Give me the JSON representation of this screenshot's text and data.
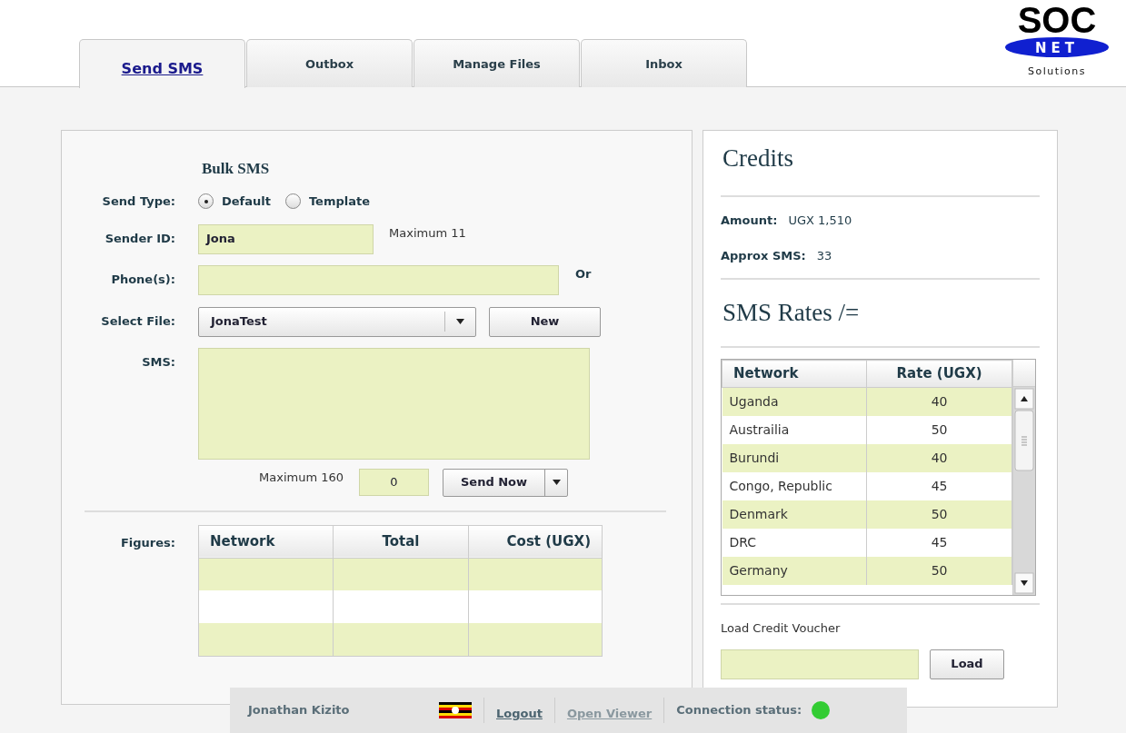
{
  "logo": {
    "top": "SOC",
    "band": "NET",
    "bottom": "Solutions"
  },
  "tabs": [
    {
      "label": "Send SMS",
      "selected": true
    },
    {
      "label": "Outbox",
      "selected": false
    },
    {
      "label": "Manage Files",
      "selected": false
    },
    {
      "label": "Inbox",
      "selected": false
    }
  ],
  "bulk_sms": {
    "title": "Bulk SMS",
    "send_type": {
      "label": "Send Type:",
      "options": [
        {
          "label": "Default",
          "selected": true
        },
        {
          "label": "Template",
          "selected": false
        }
      ]
    },
    "sender_id": {
      "label": "Sender ID:",
      "value": "Jona",
      "hint": "Maximum 11"
    },
    "phones": {
      "label": "Phone(s):",
      "hint": "Or"
    },
    "select_file": {
      "label": "Select File:",
      "value": "JonaTest",
      "button": "New"
    },
    "sms": {
      "label": "SMS:",
      "hint": "Maximum 160",
      "count": "0",
      "button": "Send Now"
    },
    "figures": {
      "label": "Figures:",
      "columns": [
        "Network",
        "Total",
        "Cost (UGX)"
      ]
    }
  },
  "credits": {
    "title": "Credits",
    "amount": {
      "label": "Amount:",
      "value": "UGX 1,510"
    },
    "approx": {
      "label": "Approx SMS:",
      "value": "33"
    },
    "rates_title": "SMS Rates /=",
    "rates": {
      "columns": [
        "Network",
        "Rate (UGX)"
      ],
      "rows": [
        [
          "Uganda",
          "40"
        ],
        [
          "Austrailia",
          "50"
        ],
        [
          "Burundi",
          "40"
        ],
        [
          "Congo, Republic",
          "45"
        ],
        [
          "Denmark",
          "50"
        ],
        [
          "DRC",
          "45"
        ],
        [
          "Germany",
          "50"
        ]
      ]
    },
    "voucher": {
      "label": "Load Credit Voucher",
      "button": "Load"
    }
  },
  "status_bar": {
    "user": "Jonathan Kizito",
    "logout": "Logout",
    "viewer": {
      "label": "Open Viewer",
      "disabled": true
    },
    "connection": {
      "label": "Connection status:",
      "color": "#33cc33"
    }
  }
}
